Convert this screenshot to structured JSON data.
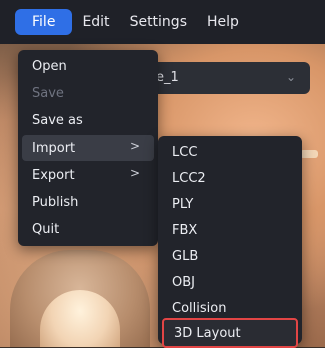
{
  "menubar": {
    "items": [
      {
        "label": "File"
      },
      {
        "label": "Edit"
      },
      {
        "label": "Settings"
      },
      {
        "label": "Help"
      }
    ]
  },
  "header": {
    "project_name_fragment": "e_1"
  },
  "file_menu": {
    "items": [
      {
        "label": "Open"
      },
      {
        "label": "Save",
        "disabled": true
      },
      {
        "label": "Save as"
      },
      {
        "label": "Import",
        "has_submenu": true
      },
      {
        "label": "Export",
        "has_submenu": true
      },
      {
        "label": "Publish"
      },
      {
        "label": "Quit"
      }
    ],
    "submenu_arrow": ">"
  },
  "import_submenu": {
    "items": [
      {
        "label": "LCC"
      },
      {
        "label": "LCC2"
      },
      {
        "label": "PLY"
      },
      {
        "label": "FBX"
      },
      {
        "label": "GLB"
      },
      {
        "label": "OBJ"
      },
      {
        "label": "Collision"
      },
      {
        "label": "3D Layout",
        "highlighted": true
      }
    ]
  },
  "colors": {
    "accent": "#2f6fe6",
    "menu_bg": "#22242b",
    "highlight_border": "#e24545"
  }
}
